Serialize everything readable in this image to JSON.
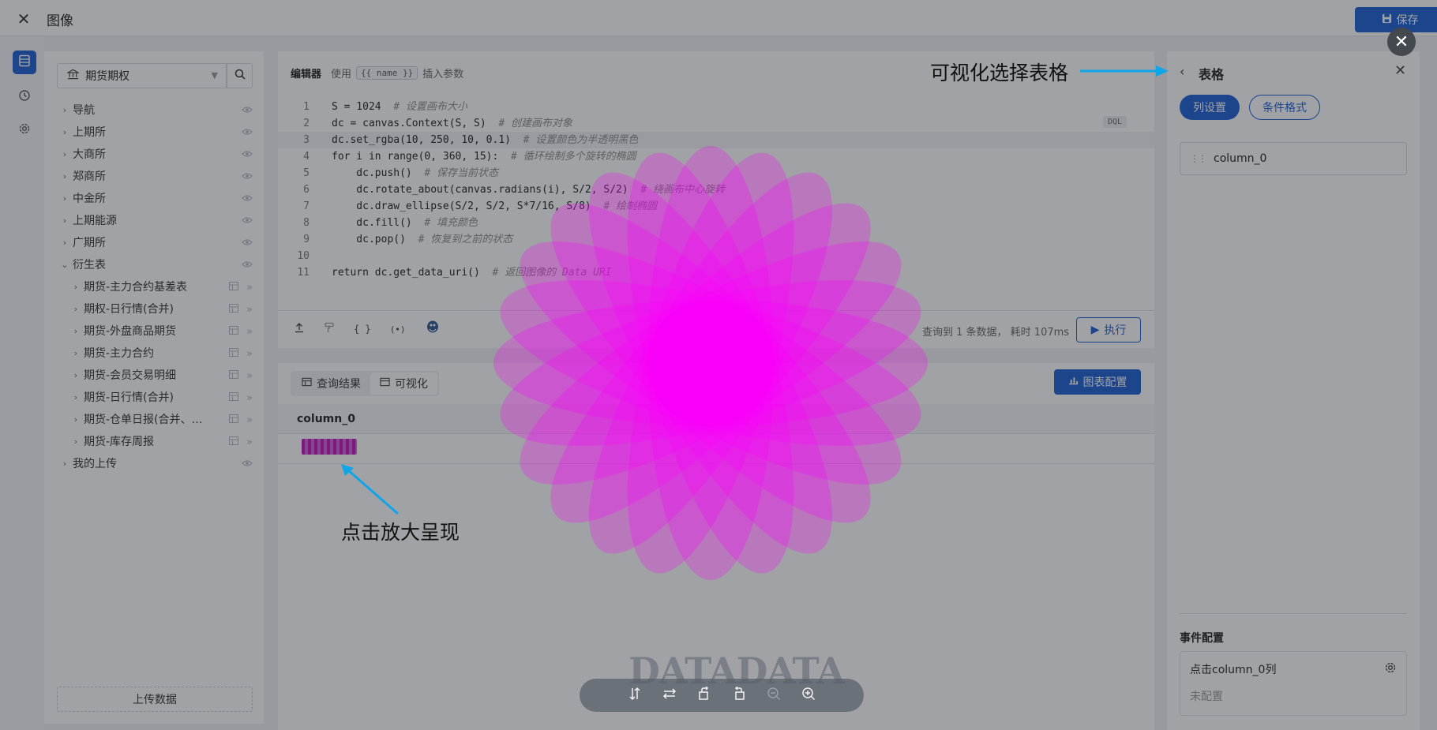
{
  "app": {
    "title": "图像",
    "save_label": "保存"
  },
  "sidebar": {
    "db_name": "期货期权",
    "items": [
      {
        "label": "导航",
        "expanded": false
      },
      {
        "label": "上期所",
        "expanded": false
      },
      {
        "label": "大商所",
        "expanded": false
      },
      {
        "label": "郑商所",
        "expanded": false
      },
      {
        "label": "中金所",
        "expanded": false
      },
      {
        "label": "上期能源",
        "expanded": false
      },
      {
        "label": "广期所",
        "expanded": false
      },
      {
        "label": "衍生表",
        "expanded": true
      }
    ],
    "sub_items": [
      "期货-主力合约基差表",
      "期权-日行情(合并)",
      "期货-外盘商品期货",
      "期货-主力合约",
      "期货-会员交易明细",
      "期货-日行情(合并)",
      "期货-仓单日报(合并、…",
      "期货-库存周报"
    ],
    "my_upload": "我的上传",
    "upload_label": "上传数据"
  },
  "editor": {
    "title": "编辑器",
    "hint_prefix": "使用",
    "hint_code": "{{ name }}",
    "hint_suffix": "插入参数",
    "lang_badge": "DQL",
    "line_numbers": [
      "1",
      "2",
      "3",
      "4",
      "5",
      "6",
      "7",
      "8",
      "9",
      "10",
      "11"
    ],
    "code": [
      {
        "code": "S = 1024",
        "comment": "# 设置画布大小"
      },
      {
        "code": "dc = canvas.Context(S, S)",
        "comment": "# 创建画布对象"
      },
      {
        "code": "dc.set_rgba(10, 250, 10, 0.1)",
        "comment": "# 设置颜色为半透明黑色"
      },
      {
        "code": "for i in range(0, 360, 15):",
        "comment": "# 循环绘制多个旋转的椭圆"
      },
      {
        "code": "    dc.push()",
        "comment": "# 保存当前状态"
      },
      {
        "code": "    dc.rotate_about(canvas.radians(i), S/2, S/2)",
        "comment": "# 绕画布中心旋转"
      },
      {
        "code": "    dc.draw_ellipse(S/2, S/2, S*7/16, S/8)",
        "comment": "# 绘制椭圆"
      },
      {
        "code": "    dc.fill()",
        "comment": "# 填充颜色"
      },
      {
        "code": "    dc.pop()",
        "comment": "# 恢复到之前的状态"
      },
      {
        "code": "",
        "comment": ""
      },
      {
        "code": "return dc.get_data_uri()",
        "comment": "# 返回图像的 Data URI"
      }
    ],
    "query_info": "查询到 1 条数据， 耗时 107ms",
    "run_label": "执行"
  },
  "results": {
    "tab_query": "查询结果",
    "tab_visual": "可视化",
    "chart_config_label": "图表配置",
    "column_header": "column_0"
  },
  "right_panel": {
    "title": "表格",
    "tab_columns": "列设置",
    "tab_conditional": "条件格式",
    "column_name": "column_0",
    "events_title": "事件配置",
    "event_name": "点击column_0列",
    "event_status": "未配置"
  },
  "overlay": {
    "annotation_table": "可视化选择表格",
    "annotation_click": "点击放大呈现",
    "watermark": "DATADATA",
    "flower_color": "#ff00ff",
    "arrow_color": "#0ea5e9"
  }
}
